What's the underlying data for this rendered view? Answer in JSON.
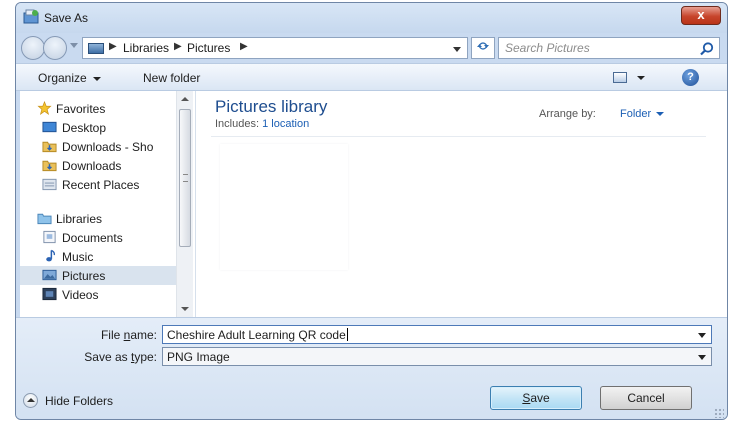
{
  "window": {
    "title": "Save As",
    "close_label": "x"
  },
  "address_bar": {
    "crumbs": [
      "Libraries",
      "Pictures"
    ],
    "separator": "▶"
  },
  "search": {
    "placeholder": "Search Pictures"
  },
  "toolbar": {
    "organize_label": "Organize",
    "new_folder_label": "New folder",
    "help_label": "?"
  },
  "nav_pane": {
    "items": [
      {
        "label": "Favorites",
        "icon": "star-icon"
      },
      {
        "label": "Desktop",
        "icon": "desktop-icon"
      },
      {
        "label": "Downloads - Sho",
        "icon": "folder-download-icon"
      },
      {
        "label": "Downloads",
        "icon": "folder-download-icon"
      },
      {
        "label": "Recent Places",
        "icon": "recent-places-icon"
      },
      {
        "label": "Libraries",
        "icon": "libraries-icon"
      },
      {
        "label": "Documents",
        "icon": "documents-icon"
      },
      {
        "label": "Music",
        "icon": "music-icon"
      },
      {
        "label": "Pictures",
        "icon": "pictures-icon",
        "selected": true
      },
      {
        "label": "Videos",
        "icon": "videos-icon"
      }
    ]
  },
  "content": {
    "title": "Pictures library",
    "includes_label": "Includes:",
    "includes_link": "1 location",
    "arrange_label": "Arrange by:",
    "arrange_value": "Folder"
  },
  "form": {
    "file_name_label_pre": "File ",
    "file_name_label_u": "n",
    "file_name_label_post": "ame:",
    "file_name_value": "Cheshire Adult Learning QR code",
    "save_type_label_pre": "Save as ",
    "save_type_label_u": "t",
    "save_type_label_post": "ype:",
    "save_type_value": "PNG Image"
  },
  "footer": {
    "hide_folders_label": "Hide Folders",
    "save_label_u": "S",
    "save_label_post": "ave",
    "cancel_label": "Cancel"
  },
  "colors": {
    "accent": "#1e4d8f",
    "link": "#1c5fb4",
    "close": "#c7452c"
  }
}
